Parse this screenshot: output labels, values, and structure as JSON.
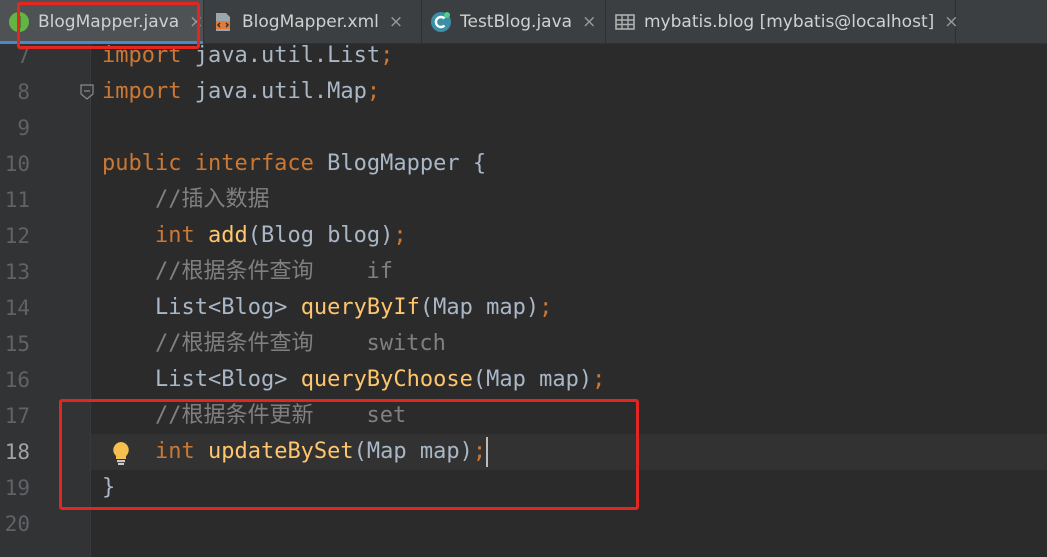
{
  "tabs": [
    {
      "label": "BlogMapper.java",
      "icon": "interface-icon",
      "active": true,
      "close": "×"
    },
    {
      "label": "BlogMapper.xml",
      "icon": "xml-file-icon",
      "active": false,
      "close": "×"
    },
    {
      "label": "TestBlog.java",
      "icon": "class-icon",
      "active": false,
      "close": "×"
    },
    {
      "label": "mybatis.blog [mybatis@localhost]",
      "icon": "table-icon",
      "active": false,
      "close": "×"
    }
  ],
  "editor": {
    "current_line": 18,
    "lines": [
      {
        "num": "7",
        "tokens": [
          {
            "t": "kw",
            "v": "import"
          },
          {
            "t": "sym",
            "v": " java.util.List"
          },
          {
            "t": "kw",
            "v": ";"
          }
        ]
      },
      {
        "num": "8",
        "tokens": [
          {
            "t": "kw",
            "v": "import"
          },
          {
            "t": "sym",
            "v": " java.util.Map"
          },
          {
            "t": "kw",
            "v": ";"
          }
        ]
      },
      {
        "num": "9",
        "tokens": []
      },
      {
        "num": "10",
        "tokens": [
          {
            "t": "kw",
            "v": "public interface "
          },
          {
            "t": "sym",
            "v": "BlogMapper {"
          }
        ]
      },
      {
        "num": "11",
        "tokens": [
          {
            "t": "cm",
            "v": "    //插入数据"
          }
        ]
      },
      {
        "num": "12",
        "tokens": [
          {
            "t": "kw",
            "v": "    int "
          },
          {
            "t": "fn",
            "v": "add"
          },
          {
            "t": "sym",
            "v": "(Blog blog)"
          },
          {
            "t": "kw",
            "v": ";"
          }
        ]
      },
      {
        "num": "13",
        "tokens": [
          {
            "t": "cm",
            "v": "    //根据条件查询    if"
          }
        ]
      },
      {
        "num": "14",
        "tokens": [
          {
            "t": "sym",
            "v": "    List<Blog> "
          },
          {
            "t": "fn",
            "v": "queryByIf"
          },
          {
            "t": "sym",
            "v": "(Map map)"
          },
          {
            "t": "kw",
            "v": ";"
          }
        ]
      },
      {
        "num": "15",
        "tokens": [
          {
            "t": "cm",
            "v": "    //根据条件查询    switch"
          }
        ]
      },
      {
        "num": "16",
        "tokens": [
          {
            "t": "sym",
            "v": "    List<Blog> "
          },
          {
            "t": "fn",
            "v": "queryByChoose"
          },
          {
            "t": "sym",
            "v": "(Map map)"
          },
          {
            "t": "kw",
            "v": ";"
          }
        ]
      },
      {
        "num": "17",
        "tokens": [
          {
            "t": "cm",
            "v": "    //根据条件更新    set"
          }
        ]
      },
      {
        "num": "18",
        "tokens": [
          {
            "t": "kw",
            "v": "    int "
          },
          {
            "t": "fn",
            "v": "updateBySet"
          },
          {
            "t": "sym",
            "v": "(Map map)"
          },
          {
            "t": "kw",
            "v": ";"
          }
        ]
      },
      {
        "num": "19",
        "tokens": [
          {
            "t": "sym",
            "v": "}"
          }
        ]
      },
      {
        "num": "20",
        "tokens": []
      }
    ]
  },
  "colors": {
    "keyword": "#cc7832",
    "method": "#ffc66d",
    "comment": "#808080",
    "text": "#a9b7c6",
    "annotation": "#e3261f"
  }
}
